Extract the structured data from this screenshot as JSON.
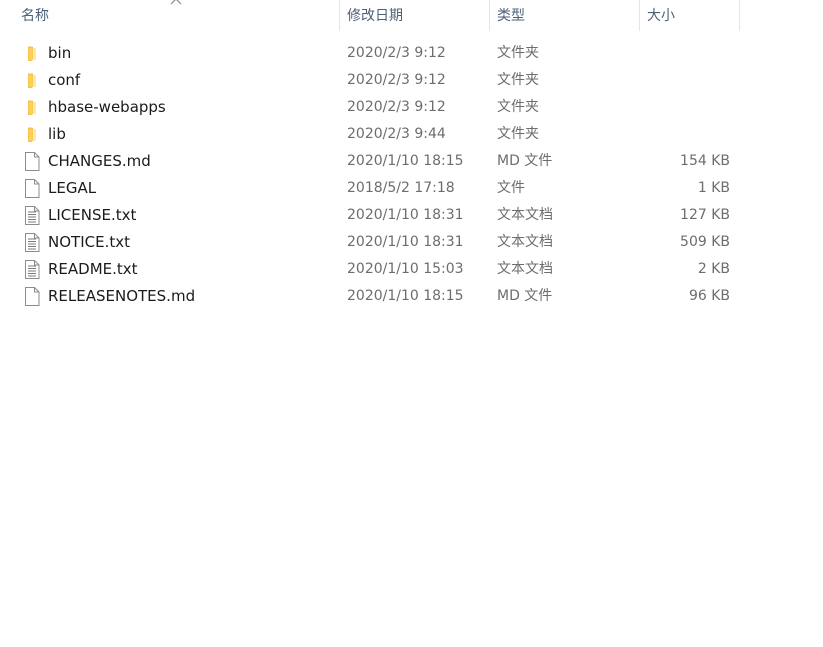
{
  "header": {
    "name_label": "名称",
    "date_label": "修改日期",
    "type_label": "类型",
    "size_label": "大小",
    "sort_indicator": "sort-ascending-icon"
  },
  "colors": {
    "header_text": "#4c607a",
    "folder_yellow": "#f8c447",
    "meta_text": "#6d6d6d"
  },
  "files": [
    {
      "name": "bin",
      "date": "2020/2/3 9:12",
      "type": "文件夹",
      "size": "",
      "icon": "folder-icon"
    },
    {
      "name": "conf",
      "date": "2020/2/3 9:12",
      "type": "文件夹",
      "size": "",
      "icon": "folder-icon"
    },
    {
      "name": "hbase-webapps",
      "date": "2020/2/3 9:12",
      "type": "文件夹",
      "size": "",
      "icon": "folder-icon"
    },
    {
      "name": "lib",
      "date": "2020/2/3 9:44",
      "type": "文件夹",
      "size": "",
      "icon": "folder-icon"
    },
    {
      "name": "CHANGES.md",
      "date": "2020/1/10 18:15",
      "type": "MD 文件",
      "size": "154 KB",
      "icon": "blank-file-icon"
    },
    {
      "name": "LEGAL",
      "date": "2018/5/2 17:18",
      "type": "文件",
      "size": "1 KB",
      "icon": "blank-file-icon"
    },
    {
      "name": "LICENSE.txt",
      "date": "2020/1/10 18:31",
      "type": "文本文档",
      "size": "127 KB",
      "icon": "text-file-icon"
    },
    {
      "name": "NOTICE.txt",
      "date": "2020/1/10 18:31",
      "type": "文本文档",
      "size": "509 KB",
      "icon": "text-file-icon"
    },
    {
      "name": "README.txt",
      "date": "2020/1/10 15:03",
      "type": "文本文档",
      "size": "2 KB",
      "icon": "text-file-icon"
    },
    {
      "name": "RELEASENOTES.md",
      "date": "2020/1/10 18:15",
      "type": "MD 文件",
      "size": "96 KB",
      "icon": "blank-file-icon"
    }
  ]
}
